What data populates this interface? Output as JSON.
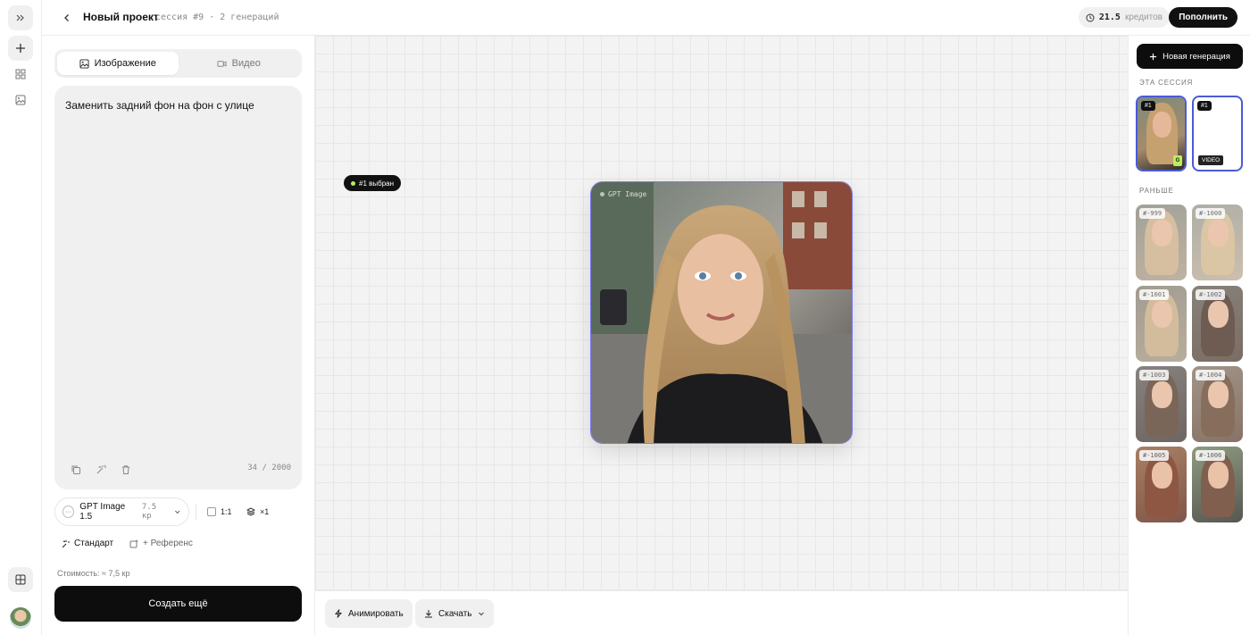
{
  "header": {
    "title": "Новый проект",
    "subtitle": "сессия #9 · 2 генераций",
    "credits_value": "21.5",
    "credits_label": "кредитов",
    "topup_label": "Пополнить"
  },
  "left_panel": {
    "tabs": [
      {
        "label": "Изображение",
        "active": true,
        "icon": "image-icon"
      },
      {
        "label": "Видео",
        "active": false,
        "icon": "video-icon"
      }
    ],
    "prompt": "Заменить задний фон на фон с улице",
    "counter": "34 / 2000",
    "model_name": "GPT Image 1.5",
    "model_cost": "7.5 кр",
    "aspect": "1:1",
    "count": "×1",
    "mode_standard": "Стандарт",
    "mode_reference": "+ Референс",
    "cost_text": "Стоимость: ≈ 7,5 кр",
    "create_label": "Создать ещё"
  },
  "canvas": {
    "selected_badge": "#1 выбран",
    "image_label": "GPT Image",
    "animate_label": "Анимировать",
    "download_label": "Скачать"
  },
  "right_panel": {
    "new_gen_label": "Новая генерация",
    "session_label": "ЭТА СЕССИЯ",
    "session_items": [
      {
        "tag": "#1",
        "badge": "G"
      },
      {
        "tag": "#1",
        "badge": "VIDEO"
      }
    ],
    "earlier_label": "РАНЬШЕ",
    "earlier_items": [
      "#-999",
      "#-1000",
      "#-1001",
      "#-1002",
      "#-1003",
      "#-1004",
      "#-1005",
      "#-1006"
    ]
  },
  "colors": {
    "accent": "#4a5bd8",
    "lime": "#b9ef5c",
    "dark": "#0d0d0d"
  }
}
